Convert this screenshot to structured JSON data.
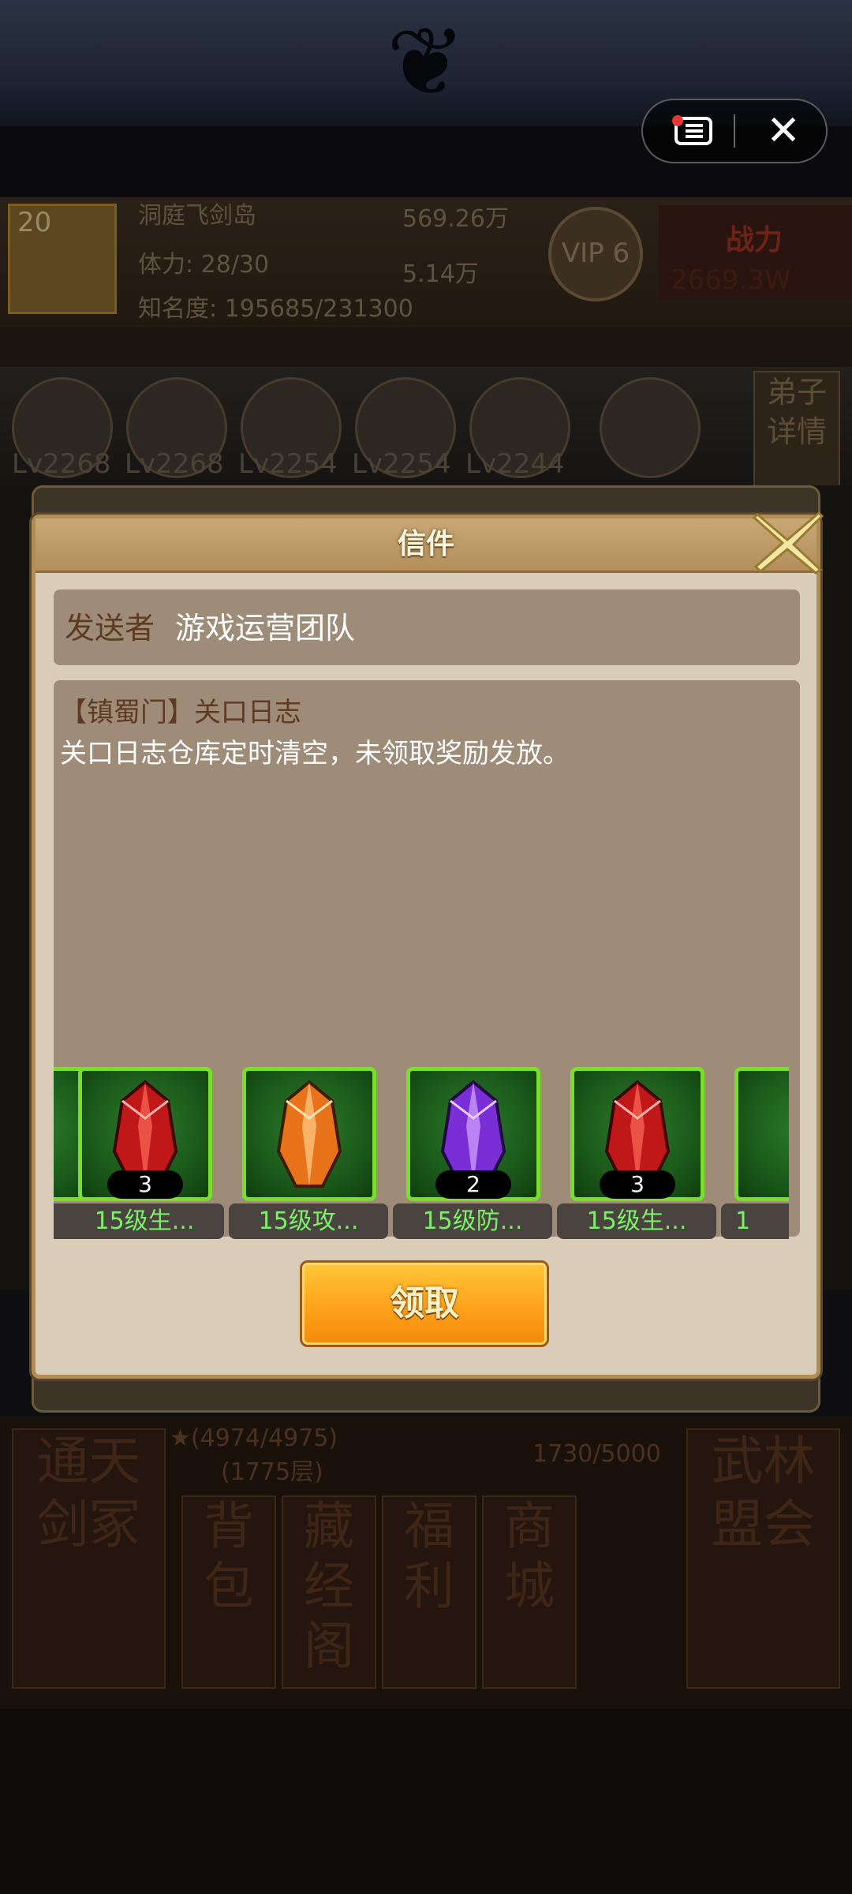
{
  "background": {
    "guild_name": "洞庭飞剑岛",
    "level": "20",
    "stamina": "体力: 28/30",
    "fame": "知名度: 195685/231300",
    "silver": "569.26万",
    "gold": "5.14万",
    "vip": "VIP 6",
    "power_label": "战力",
    "power_value": "2669.3W",
    "hero_levels": [
      "Lv2268",
      "Lv2268",
      "Lv2254",
      "Lv2254",
      "Lv2244"
    ],
    "disciple_button": "弟子详情",
    "stars": "★(4974/4975)",
    "floors": "(1775层)",
    "progress": "1730/5000",
    "tiles": [
      "通天剑冢",
      "背包",
      "藏经阁",
      "福利",
      "商城",
      "武林盟会"
    ]
  },
  "top_controls": {
    "menu_icon": "menu-icon",
    "close_icon": "close-icon",
    "close_symbol": "✕"
  },
  "mail": {
    "title": "信件",
    "sender_label": "发送者",
    "sender_name": "游戏运营团队",
    "subject": "【镇蜀门】关口日志",
    "body": "关口日志仓库定时清空，未领取奖励发放。",
    "rewards": [
      {
        "name": "...",
        "count": "",
        "gem_color": "#d0312d",
        "partial": "left"
      },
      {
        "name": "15级生...",
        "count": "3",
        "gem_color": "#d0312d"
      },
      {
        "name": "15级攻...",
        "count": "",
        "gem_color": "#ee7a1e"
      },
      {
        "name": "15级防...",
        "count": "2",
        "gem_color": "#8a3fe0"
      },
      {
        "name": "15级生...",
        "count": "3",
        "gem_color": "#d0312d"
      },
      {
        "name": "1",
        "count": "",
        "gem_color": "#d0312d",
        "partial": "right"
      }
    ],
    "claim_button": "领取"
  }
}
